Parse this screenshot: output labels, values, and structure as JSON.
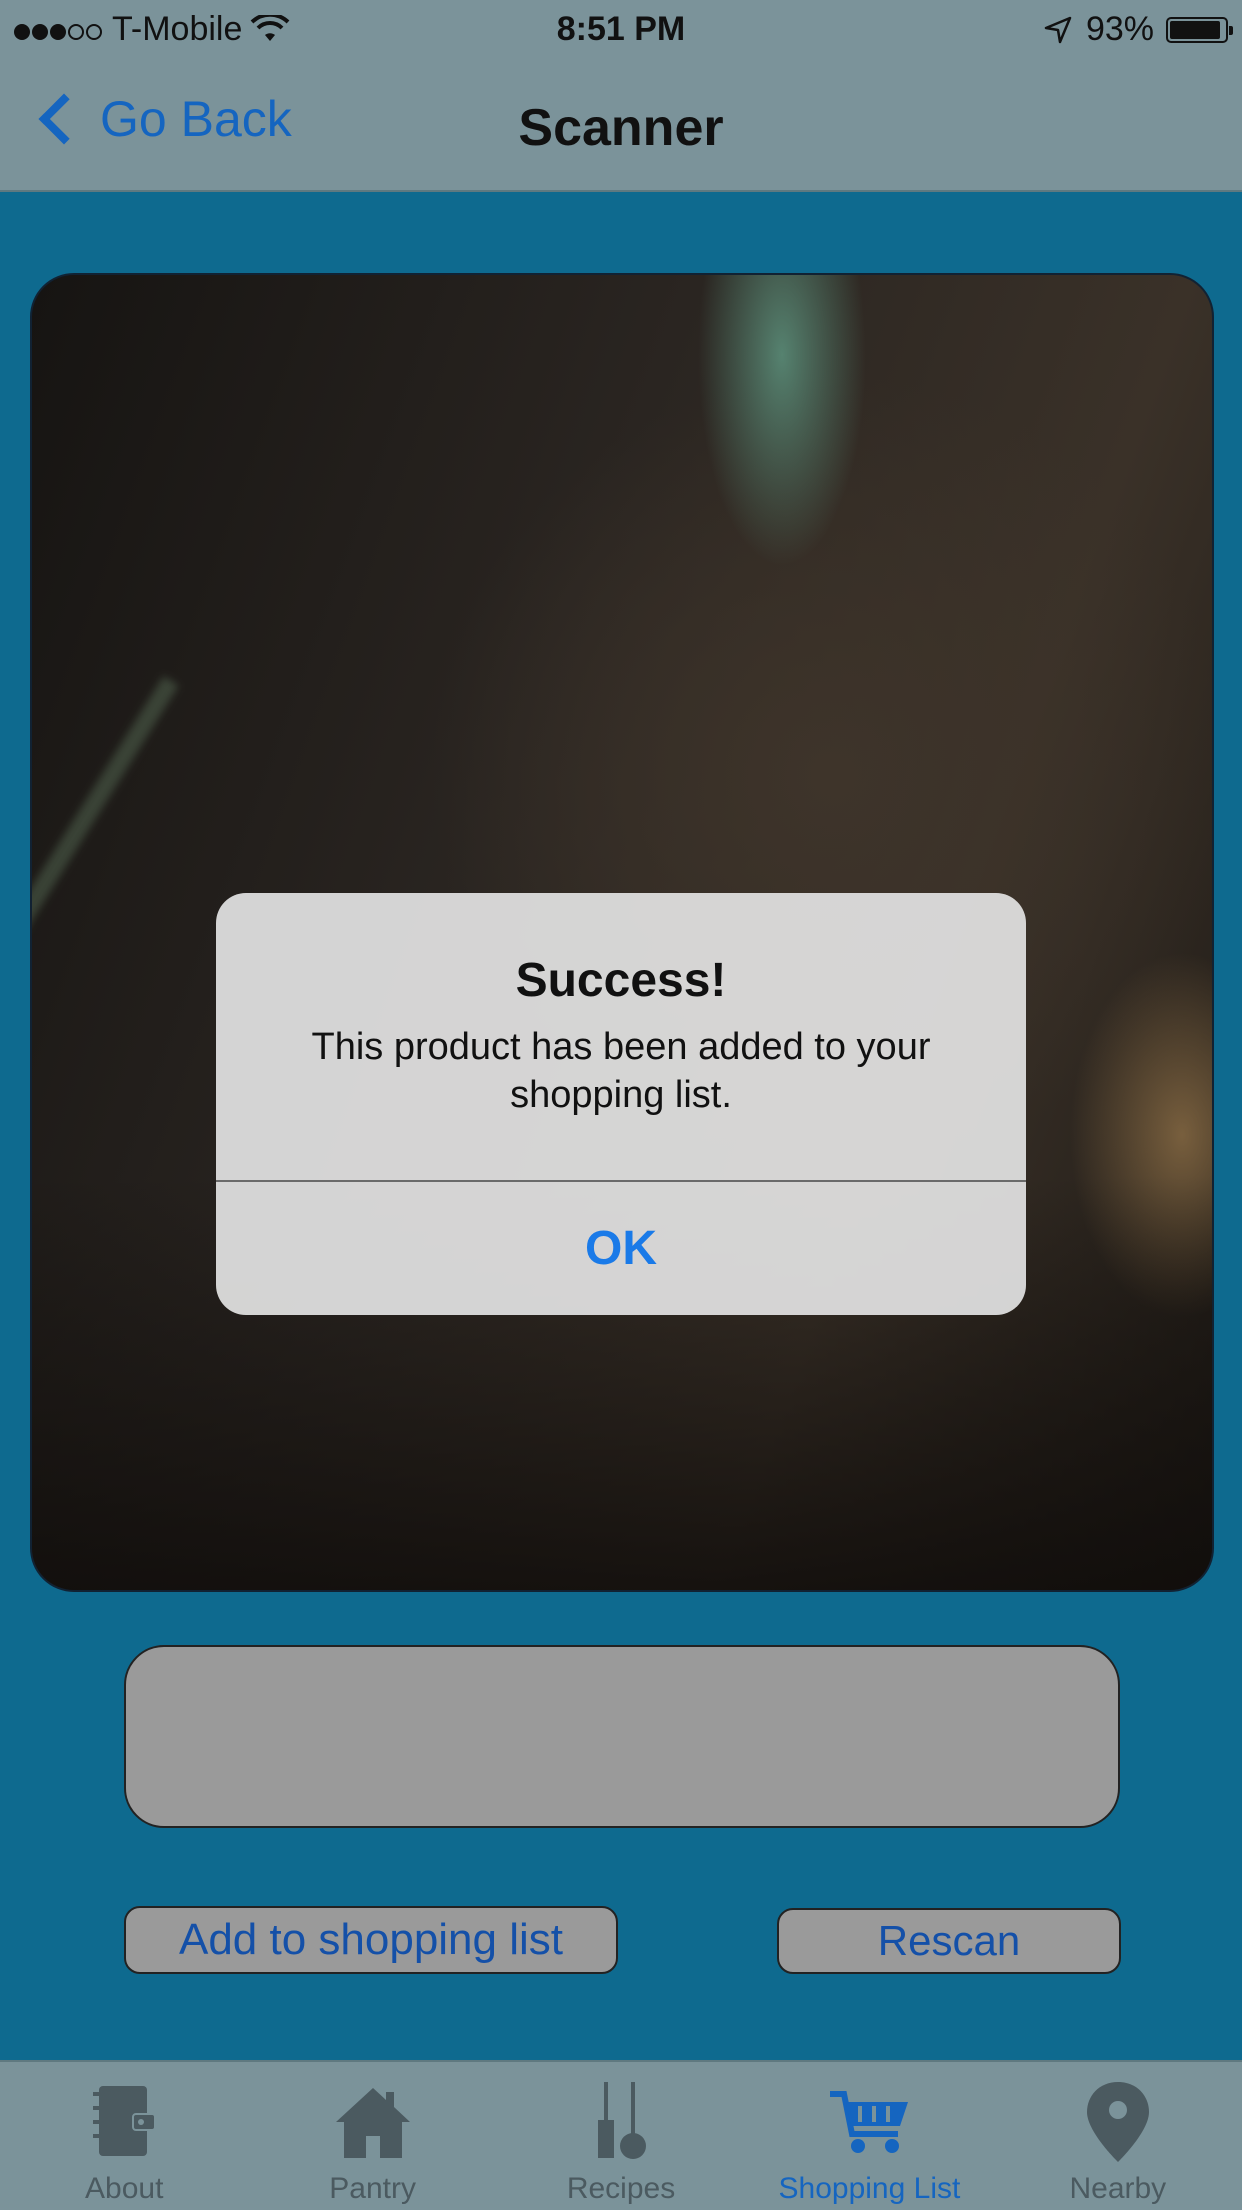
{
  "status_bar": {
    "carrier": "T-Mobile",
    "time": "8:51 PM",
    "battery_percent": "93%",
    "battery_level": 0.93,
    "signal_bars_filled": 3,
    "signal_bars_total": 5
  },
  "nav": {
    "back_label": "Go Back",
    "title": "Scanner"
  },
  "main": {
    "scan_result_value": "",
    "add_button_label": "Add to shopping list",
    "rescan_button_label": "Rescan"
  },
  "alert": {
    "title": "Success!",
    "message": "This product has been added to your shopping list.",
    "ok_label": "OK"
  },
  "tabs": [
    {
      "label": "About",
      "icon": "planner-icon",
      "active": false
    },
    {
      "label": "Pantry",
      "icon": "house-icon",
      "active": false
    },
    {
      "label": "Recipes",
      "icon": "utensils-icon",
      "active": false
    },
    {
      "label": "Shopping List",
      "icon": "cart-icon",
      "active": true
    },
    {
      "label": "Nearby",
      "icon": "location-pin-icon",
      "active": false
    }
  ],
  "colors": {
    "background": "#0e6a8f",
    "bars": "#7b939a",
    "accent": "#1565c0",
    "alert_ok": "#1a7ae8"
  }
}
